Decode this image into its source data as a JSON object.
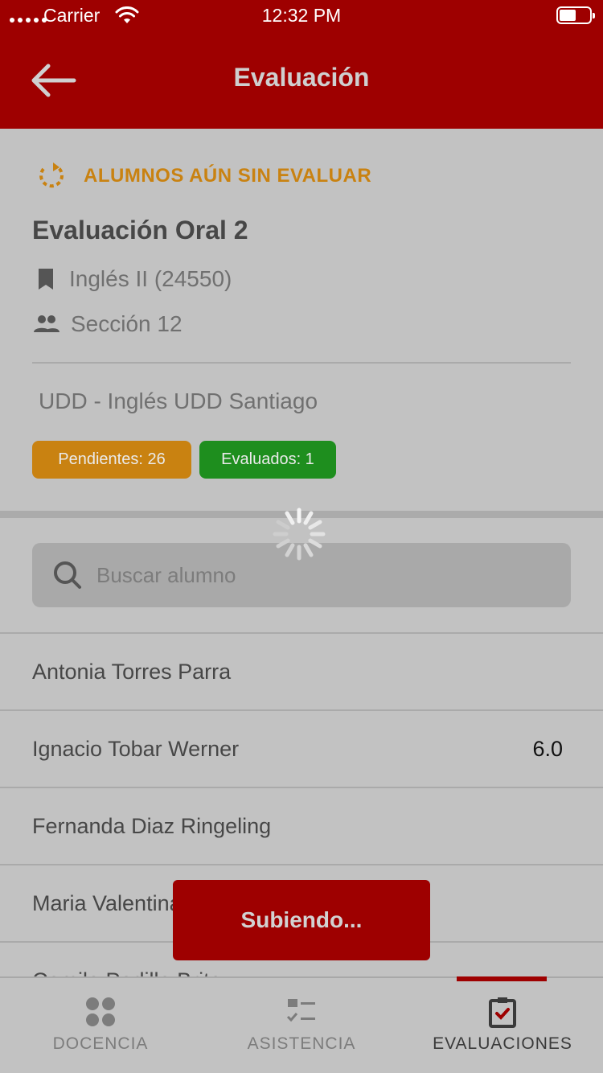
{
  "status_bar": {
    "carrier": "Carrier",
    "time": "12:32 PM"
  },
  "nav": {
    "title": "Evaluación"
  },
  "evaluation": {
    "status_label": "ALUMNOS AÚN SIN EVALUAR",
    "title": "Evaluación Oral 2",
    "course": "Inglés II (24550)",
    "section": "Sección 12",
    "institution": "UDD - Inglés UDD Santiago",
    "pending_label": "Pendientes: 26",
    "evaluated_label": "Evaluados: 1"
  },
  "search": {
    "placeholder": "Buscar alumno",
    "value": ""
  },
  "students": [
    {
      "name": "Antonia Torres Parra",
      "grade": ""
    },
    {
      "name": "Ignacio Tobar Werner",
      "grade": "6.0"
    },
    {
      "name": "Fernanda Diaz Ringeling",
      "grade": ""
    },
    {
      "name": "Maria Valentina",
      "grade": ""
    },
    {
      "name": "Camilo Padilla Brito",
      "grade": ""
    }
  ],
  "toast": {
    "text": "Subiendo..."
  },
  "tabs": [
    {
      "label": "DOCENCIA",
      "icon": "grid-icon",
      "active": false
    },
    {
      "label": "ASISTENCIA",
      "icon": "checklist-icon",
      "active": false
    },
    {
      "label": "EVALUACIONES",
      "icon": "clipboard-check-icon",
      "active": true
    }
  ],
  "colors": {
    "brand_red": "#9e0000",
    "pending": "#c98211",
    "evaluated": "#1e8e1e",
    "background": "#c2c2c2"
  }
}
